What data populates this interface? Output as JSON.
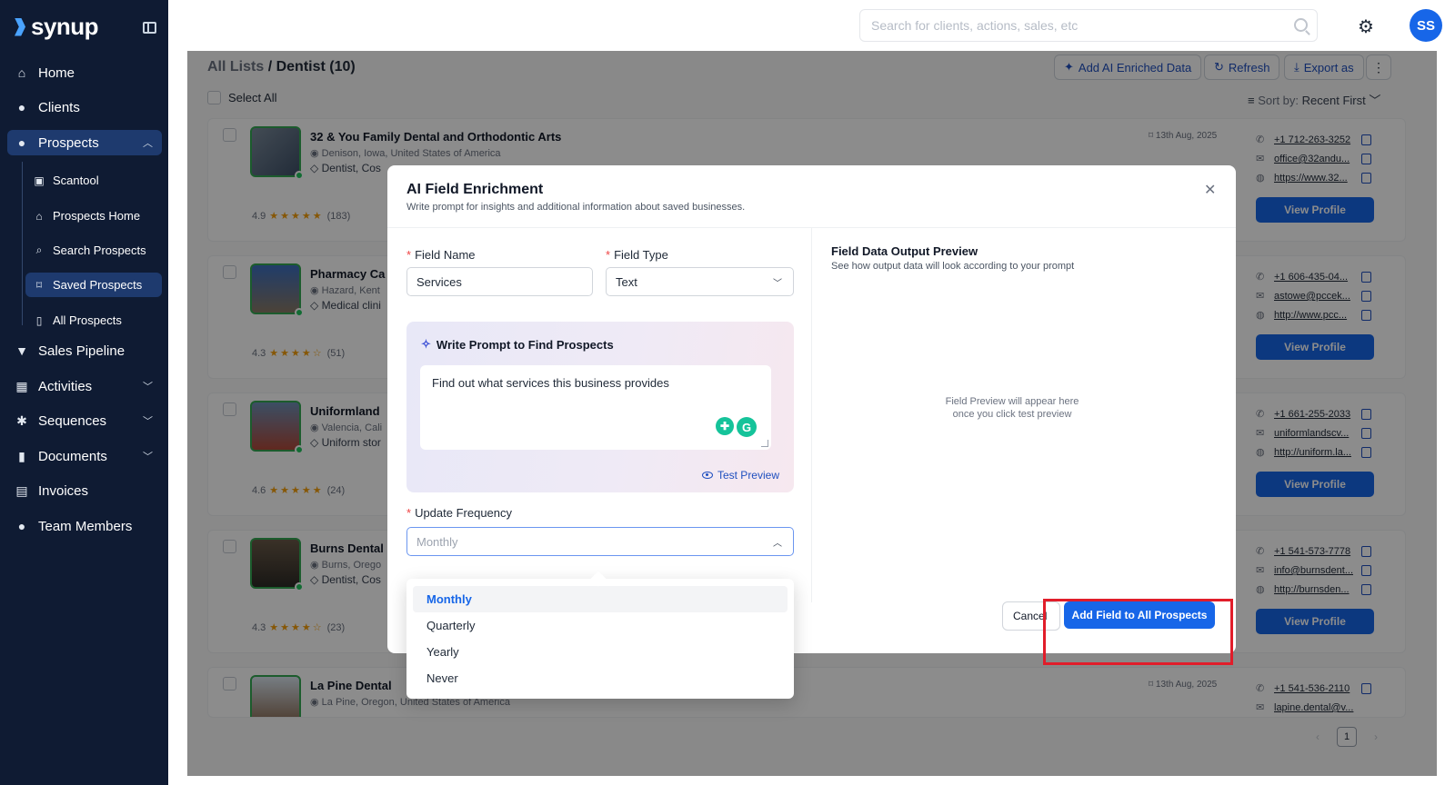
{
  "sidebar": {
    "brand": "synup",
    "nav": [
      {
        "label": "Home",
        "icon": "home-icon"
      },
      {
        "label": "Clients",
        "icon": "user-icon"
      },
      {
        "label": "Prospects",
        "icon": "users-icon"
      },
      {
        "label": "Sales Pipeline",
        "icon": "funnel-icon"
      },
      {
        "label": "Activities",
        "icon": "calendar-icon"
      },
      {
        "label": "Sequences",
        "icon": "gear-icon"
      },
      {
        "label": "Documents",
        "icon": "document-icon"
      },
      {
        "label": "Invoices",
        "icon": "invoice-icon"
      },
      {
        "label": "Team Members",
        "icon": "team-icon"
      }
    ],
    "prospects_sub": [
      {
        "label": "Scantool",
        "icon": "scan-icon"
      },
      {
        "label": "Prospects Home",
        "icon": "home-icon"
      },
      {
        "label": "Search Prospects",
        "icon": "search-icon"
      },
      {
        "label": "Saved Prospects",
        "icon": "bookmark-icon"
      },
      {
        "label": "All Prospects",
        "icon": "book-icon"
      }
    ]
  },
  "topbar": {
    "search_placeholder": "Search for clients, actions, sales, etc",
    "avatar_initials": "SS"
  },
  "main": {
    "breadcrumb_root": "All Lists",
    "breadcrumb_sep": "/",
    "breadcrumb_current": "Dentist (10)",
    "actions": {
      "ai": "Add AI Enriched Data",
      "refresh": "Refresh",
      "export": "Export as"
    },
    "select_all": "Select All",
    "sort_label": "Sort by:",
    "sort_value": "Recent First",
    "view_profile": "View Profile",
    "cards": [
      {
        "name": "32 & You Family Dental and Orthodontic Arts",
        "location": "Denison, Iowa, United States of America",
        "category": "Dentist, Cos",
        "rating": "4.9",
        "stars": "★★★★★",
        "reviews": "(183)",
        "date": "13th Aug, 2025",
        "phone": "+1 712-263-3252",
        "email": "office@32andu...",
        "website": "https://www.32..."
      },
      {
        "name": "Pharmacy Ca",
        "location": "Hazard, Kent",
        "category": "Medical clini",
        "rating": "4.3",
        "stars": "★★★★☆",
        "reviews": "(51)",
        "date": "",
        "phone": "+1 606-435-04...",
        "email": "astowe@pccek...",
        "website": "http://www.pcc..."
      },
      {
        "name": "Uniformland",
        "location": "Valencia, Cali",
        "category": "Uniform stor",
        "rating": "4.6",
        "stars": "★★★★★",
        "reviews": "(24)",
        "date": "",
        "phone": "+1 661-255-2033",
        "email": "uniformlandscv...",
        "website": "http://uniform.la..."
      },
      {
        "name": "Burns Dental",
        "location": "Burns, Orego",
        "category": "Dentist, Cos",
        "rating": "4.3",
        "stars": "★★★★☆",
        "reviews": "(23)",
        "date": "",
        "phone": "+1 541-573-7778",
        "email": "info@burnsdent...",
        "website": "http://burnsden..."
      },
      {
        "name": "La Pine Dental",
        "location": "La Pine, Oregon, United States of America",
        "category": "",
        "rating": "",
        "stars": "",
        "reviews": "",
        "date": "13th Aug, 2025",
        "phone": "+1 541-536-2110",
        "email": "lapine.dental@v...",
        "website": ""
      }
    ],
    "page": "1"
  },
  "modal": {
    "title": "AI Field Enrichment",
    "subtitle": "Write prompt for insights and additional information about saved businesses.",
    "field_name_label": "Field Name",
    "field_name_value": "Services",
    "field_type_label": "Field Type",
    "field_type_value": "Text",
    "prompt_title": "Write Prompt to Find Prospects",
    "prompt_value": "Find out what services this business provides",
    "test_preview": "Test Preview",
    "update_frequency_label": "Update Frequency",
    "update_frequency_placeholder": "Monthly",
    "preview_title": "Field Data Output Preview",
    "preview_subtitle": "See how output data will look according to your prompt",
    "preview_empty_line1": "Field Preview will appear here",
    "preview_empty_line2": "once you click test preview",
    "cancel": "Cancel",
    "submit": "Add Field to All Prospects",
    "frequency_options": [
      "Monthly",
      "Quarterly",
      "Yearly",
      "Never"
    ],
    "selected_option": "Monthly"
  }
}
